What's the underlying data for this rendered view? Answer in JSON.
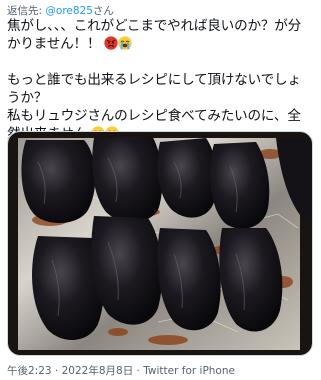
{
  "tweet": {
    "reply_prefix": "返信先: ",
    "reply_handle": "@ore825",
    "reply_suffix": "さん",
    "lines": [
      "焦がし、、、これがどこまでやれば良いのか？が分かりません！！",
      "もっと誰でも出来るレシピにして頂けないでしょうか？",
      "私もリュウジさんのレシピ食べてみたいのに、全然出来ません"
    ],
    "emojis": {
      "line1": [
        "angry-face-icon",
        "loudly-crying-face-icon"
      ],
      "line3": [
        "loudly-crying-face-icon",
        "loudly-crying-face-icon"
      ]
    },
    "photo": {
      "subject": "charred-peppers-on-foil-tray"
    },
    "time": "午後2:23",
    "date": "2022年8月8日",
    "source": "Twitter for iPhone",
    "separator": " · "
  }
}
